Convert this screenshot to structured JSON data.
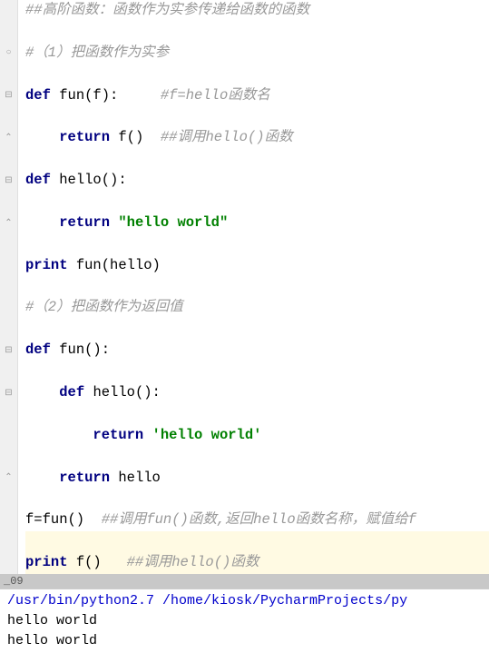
{
  "editor": {
    "lines": [
      {
        "type": "comment",
        "text": "##高阶函数：函数作为实参传递给函数的函数",
        "fold": false
      },
      {
        "type": "blank",
        "text": "",
        "fold": false
      },
      {
        "type": "comment",
        "text": "#（1）把函数作为实参",
        "fold": "fold"
      },
      {
        "type": "blank",
        "text": "",
        "fold": false
      },
      {
        "type": "def",
        "keyword": "def ",
        "name": "fun",
        "params": "(f):",
        "trail_comment": "     #f=hello函数名",
        "fold": "open"
      },
      {
        "type": "blank",
        "text": "",
        "fold": false
      },
      {
        "type": "return",
        "indent": "    ",
        "keyword": "return ",
        "rest": "f()",
        "trail_comment": "  ##调用hello()函数",
        "fold": "close"
      },
      {
        "type": "blank",
        "text": "",
        "fold": false
      },
      {
        "type": "def",
        "keyword": "def ",
        "name": "hello",
        "params": "():",
        "trail_comment": "",
        "fold": "open"
      },
      {
        "type": "blank",
        "text": "",
        "fold": false
      },
      {
        "type": "return-str",
        "indent": "    ",
        "keyword": "return ",
        "string": "\"hello world\"",
        "fold": "close"
      },
      {
        "type": "blank",
        "text": "",
        "fold": false
      },
      {
        "type": "print",
        "keyword": "print ",
        "rest": "fun(hello)",
        "fold": false
      },
      {
        "type": "blank",
        "text": "",
        "fold": false
      },
      {
        "type": "comment",
        "text": "#（2）把函数作为返回值",
        "fold": false
      },
      {
        "type": "blank",
        "text": "",
        "fold": false
      },
      {
        "type": "def",
        "keyword": "def ",
        "name": "fun",
        "params": "():",
        "trail_comment": "",
        "fold": "open"
      },
      {
        "type": "blank",
        "text": "",
        "fold": false
      },
      {
        "type": "def-nested",
        "indent": "    ",
        "keyword": "def ",
        "name": "hello",
        "params": "():",
        "fold": "open"
      },
      {
        "type": "blank",
        "text": "",
        "fold": false
      },
      {
        "type": "return-str",
        "indent": "        ",
        "keyword": "return ",
        "string": "'hello world'",
        "fold": false
      },
      {
        "type": "blank",
        "text": "",
        "fold": false
      },
      {
        "type": "return",
        "indent": "    ",
        "keyword": "return ",
        "rest": "hello",
        "trail_comment": "",
        "fold": "close"
      },
      {
        "type": "blank",
        "text": "",
        "fold": false
      },
      {
        "type": "assign",
        "text": "f=fun()",
        "trail_comment": "  ##调用fun()函数,返回hello函数名称，赋值给f",
        "fold": false
      },
      {
        "type": "blank",
        "text": "",
        "fold": false,
        "highlight": true
      },
      {
        "type": "print",
        "keyword": "print ",
        "rest": "f()",
        "trail_comment": "   ##调用hello()函数",
        "fold": false,
        "highlight": true
      }
    ]
  },
  "status": {
    "text": "_09"
  },
  "console": {
    "path": "/usr/bin/python2.7 /home/kiosk/PycharmProjects/py",
    "output": [
      "hello world",
      "hello world"
    ]
  }
}
